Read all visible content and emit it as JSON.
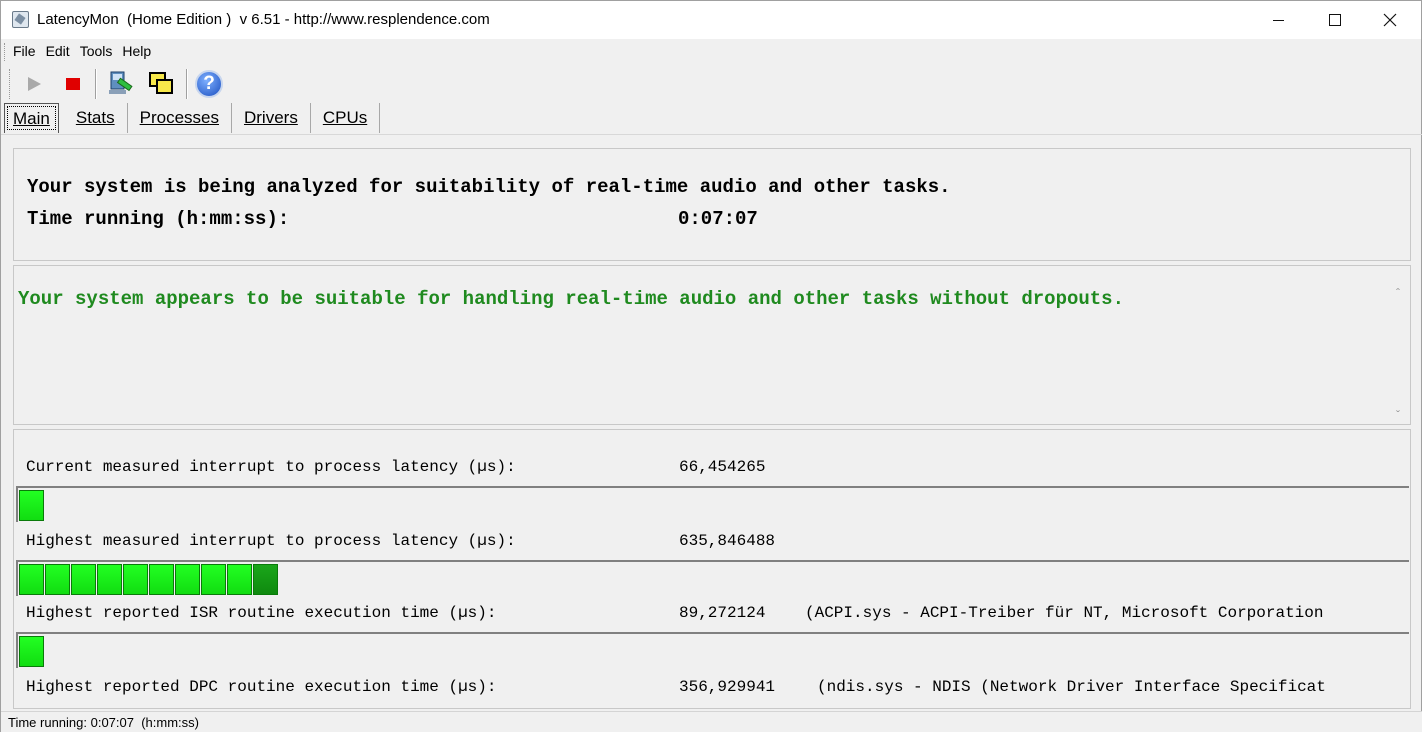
{
  "window": {
    "title": "LatencyMon  (Home Edition )  v 6.51 - http://www.resplendence.com"
  },
  "menu": {
    "items": [
      "File",
      "Edit",
      "Tools",
      "Help"
    ]
  },
  "toolbar": {
    "icons": [
      "play-icon",
      "stop-icon",
      "hammer-icon",
      "windows-icon",
      "help-icon"
    ],
    "help_glyph": "?"
  },
  "tabs": [
    "Main",
    "Stats",
    "Processes",
    "Drivers",
    "CPUs"
  ],
  "analysis": {
    "line1": "Your system is being analyzed for suitability of real-time audio and other tasks.",
    "time_label": "Time running (h:mm:ss):",
    "time_value": "0:07:07"
  },
  "verdict": {
    "message": "Your system appears to be suitable for handling real-time audio and other tasks without dropouts.",
    "color": "#1f8a1f"
  },
  "measurements": [
    {
      "label": "Current measured interrupt to process latency (µs):",
      "value": "66,454265",
      "extra": "",
      "bar_segments": 1
    },
    {
      "label": "Highest measured interrupt to process latency (µs):",
      "value": "635,846488",
      "extra": "",
      "bar_segments": 10
    },
    {
      "label": "Highest reported ISR routine execution time (µs):",
      "value": "89,272124",
      "extra": "(ACPI.sys - ACPI-Treiber für NT, Microsoft Corporation",
      "bar_segments": 1
    },
    {
      "label": "Highest reported DPC routine execution time (µs):",
      "value": "356,929941",
      "extra": "(ndis.sys - NDIS (Network Driver Interface Specificat",
      "bar_segments": 0
    }
  ],
  "statusbar": {
    "text": "Time running: 0:07:07  (h:mm:ss)"
  },
  "colors": {
    "bar_green": "#22ff22",
    "bar_dark_green": "#1aa61a",
    "stop_red": "#e00000"
  }
}
